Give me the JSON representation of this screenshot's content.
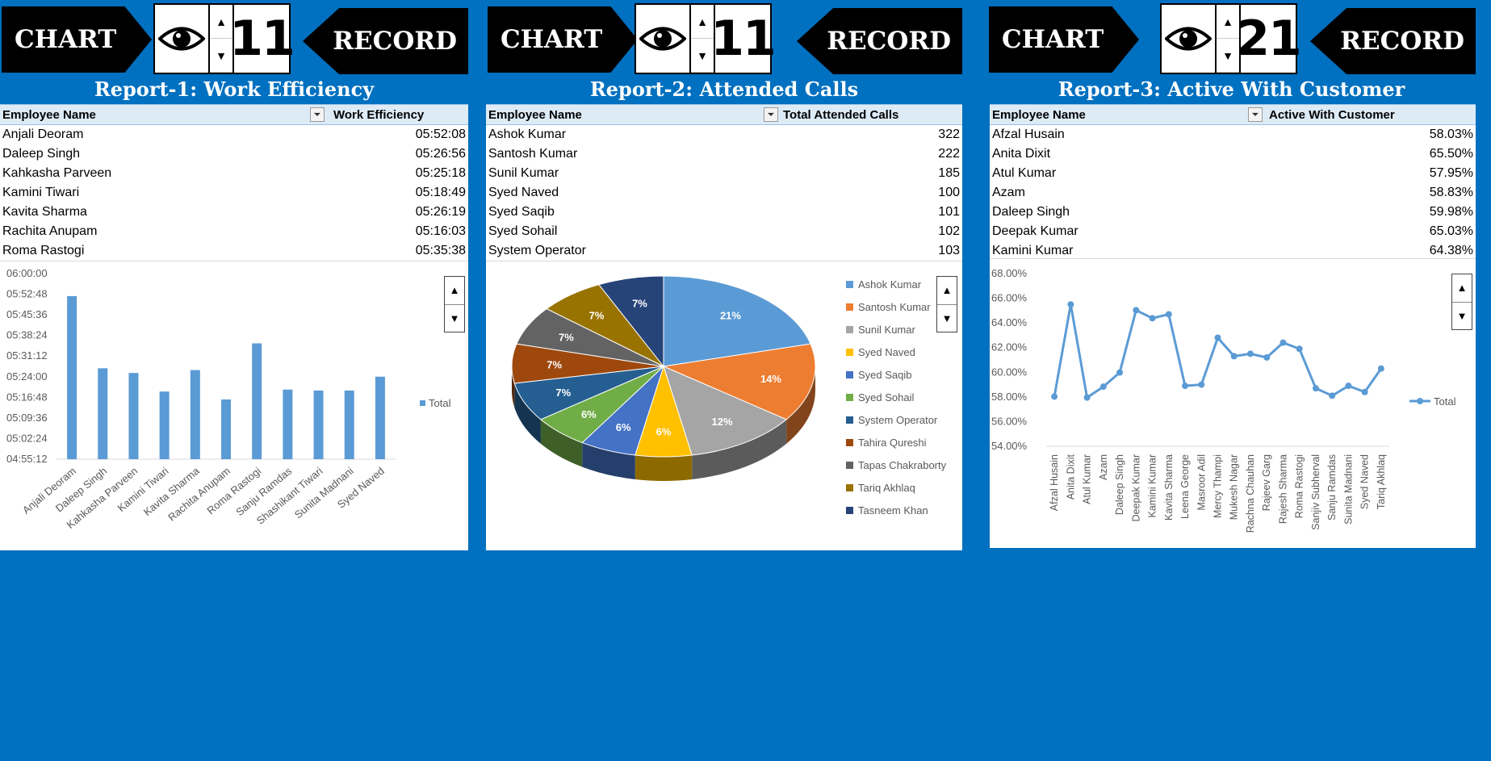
{
  "panels": [
    {
      "chart_button": "CHART",
      "record_button": "RECORD",
      "counter": "11",
      "title": "Report-1: Work Efficiency",
      "headers": [
        "Employee Name",
        "Work Efficiency"
      ],
      "rows": [
        [
          "Anjali Deoram",
          "05:52:08"
        ],
        [
          "Daleep Singh",
          "05:26:56"
        ],
        [
          "Kahkasha Parveen",
          "05:25:18"
        ],
        [
          "Kamini Tiwari",
          "05:18:49"
        ],
        [
          "Kavita Sharma",
          "05:26:19"
        ],
        [
          "Rachita Anupam",
          "05:16:03"
        ],
        [
          "Roma Rastogi",
          "05:35:38"
        ]
      ]
    },
    {
      "chart_button": "CHART",
      "record_button": "RECORD",
      "counter": "11",
      "title": "Report-2: Attended Calls",
      "headers": [
        "Employee Name",
        "Total Attended Calls"
      ],
      "rows": [
        [
          "Ashok Kumar",
          "322"
        ],
        [
          "Santosh Kumar",
          "222"
        ],
        [
          "Sunil Kumar",
          "185"
        ],
        [
          "Syed Naved",
          "100"
        ],
        [
          "Syed Saqib",
          "101"
        ],
        [
          "Syed Sohail",
          "102"
        ],
        [
          "System Operator",
          "103"
        ]
      ]
    },
    {
      "chart_button": "CHART",
      "record_button": "RECORD",
      "counter": "21",
      "title": "Report-3: Active With Customer",
      "headers": [
        "Employee Name",
        "Active With Customer"
      ],
      "rows": [
        [
          "Afzal Husain",
          "58.03%"
        ],
        [
          "Anita Dixit",
          "65.50%"
        ],
        [
          "Atul Kumar",
          "57.95%"
        ],
        [
          "Azam",
          "58.83%"
        ],
        [
          "Daleep Singh",
          "59.98%"
        ],
        [
          "Deepak Kumar",
          "65.03%"
        ],
        [
          "Kamini Kumar",
          "64.38%"
        ]
      ]
    }
  ],
  "spinner": {
    "up": "▲",
    "down": "▼"
  },
  "chart_data": [
    {
      "type": "bar",
      "categories": [
        "Anjali Deoram",
        "Daleep Singh",
        "Kahkasha Parveen",
        "Kamini Tiwari",
        "Kavita Sharma",
        "Rachita Anupam",
        "Roma Rastogi",
        "Sanju Ramdas",
        "Shashikant Tiwari",
        "Sunita Madnani",
        "Syed Naved"
      ],
      "series": [
        {
          "name": "Total",
          "values": [
            "05:52:08",
            "05:26:56",
            "05:25:18",
            "05:18:49",
            "05:26:19",
            "05:16:03",
            "05:35:38",
            "05:19:30",
            "05:19:10",
            "05:19:10",
            "05:24:00"
          ],
          "color": "#5b9bd5"
        }
      ],
      "yticks": [
        "06:00:00",
        "05:52:48",
        "05:45:36",
        "05:38:24",
        "05:31:12",
        "05:24:00",
        "05:16:48",
        "05:09:36",
        "05:02:24",
        "04:55:12"
      ],
      "ylim": [
        "04:55:12",
        "06:00:00"
      ],
      "legend": "right"
    },
    {
      "type": "pie",
      "labels": [
        "Ashok Kumar",
        "Santosh Kumar",
        "Sunil Kumar",
        "Syed Naved",
        "Syed Saqib",
        "Syed Sohail",
        "System Operator",
        "Tahira Qureshi",
        "Tapas Chakraborty",
        "Tariq Akhlaq",
        "Tasneem Khan"
      ],
      "values": [
        21,
        14,
        12,
        6,
        6,
        6,
        7,
        7,
        7,
        7,
        7
      ],
      "data_labels": [
        "21%",
        "14%",
        "12%",
        "6%",
        "6%",
        "6%",
        "7%",
        "7%",
        "7%",
        "7%",
        "7%"
      ],
      "colors": [
        "#5b9bd5",
        "#ed7d31",
        "#a5a5a5",
        "#ffc000",
        "#4472c4",
        "#70ad47",
        "#255e91",
        "#9e480e",
        "#636363",
        "#997300",
        "#264478"
      ],
      "legend": "right"
    },
    {
      "type": "line",
      "categories": [
        "Afzal Husain",
        "Anita Dixit",
        "Atul Kumar",
        "Azam",
        "Daleep Singh",
        "Deepak Kumar",
        "Kamini Kumar",
        "Kavita Sharma",
        "Leena George",
        "Masroor Adil",
        "Mercy Thampi",
        "Mukesh Nagar",
        "Rachna Chauhan",
        "Rajeev Garg",
        "Rajesh Sharma",
        "Roma Rastogi",
        "Sanjiv Subherval",
        "Sanju Ramdas",
        "Sunita Madnani",
        "Syed Naved",
        "Tariq Akhlaq"
      ],
      "series": [
        {
          "name": "Total",
          "values": [
            58.03,
            65.5,
            57.95,
            58.83,
            59.98,
            65.03,
            64.38,
            64.7,
            58.9,
            59.0,
            62.8,
            61.3,
            61.5,
            61.2,
            62.4,
            61.9,
            58.7,
            58.1,
            58.9,
            58.4,
            60.3
          ],
          "color": "#5b9bd5"
        }
      ],
      "yticks": [
        "68.00%",
        "66.00%",
        "64.00%",
        "62.00%",
        "60.00%",
        "58.00%",
        "56.00%",
        "54.00%"
      ],
      "ylim": [
        54,
        68
      ],
      "legend": "right"
    }
  ]
}
